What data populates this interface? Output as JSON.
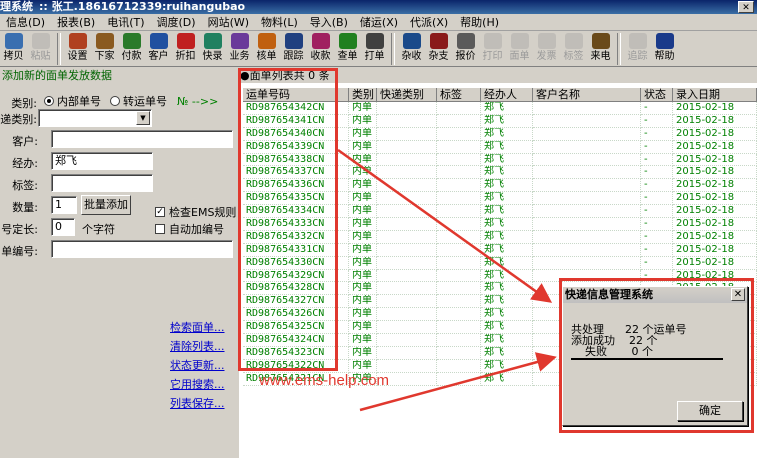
{
  "window": {
    "title": "理系统",
    "user": ":: 张工.18616712339:ruihangubao",
    "close_glyph": "✕"
  },
  "menu": [
    "信息(D)",
    "报表(B)",
    "电讯(T)",
    "调度(D)",
    "网站(W)",
    "物料(L)",
    "导入(B)",
    "储运(X)",
    "代派(X)",
    "帮助(H)"
  ],
  "toolbar": [
    {
      "label": "拷贝",
      "icon": "copy-icon",
      "color": "#3a6fb0",
      "enabled": true
    },
    {
      "label": "粘贴",
      "icon": "paste-icon",
      "color": "#9a9a9a",
      "enabled": false
    },
    {
      "sep": true
    },
    {
      "label": "设置",
      "icon": "settings-icon",
      "color": "#b04020",
      "enabled": true
    },
    {
      "label": "下家",
      "icon": "downstream-icon",
      "color": "#8a5a20",
      "enabled": true
    },
    {
      "label": "付款",
      "icon": "payment-icon",
      "color": "#2a7a2a",
      "enabled": true
    },
    {
      "label": "客户",
      "icon": "customer-icon",
      "color": "#2050a0",
      "enabled": true
    },
    {
      "label": "折扣",
      "icon": "discount-icon",
      "color": "#c02020",
      "enabled": true
    },
    {
      "label": "快录",
      "icon": "quick-entry-icon",
      "color": "#208060",
      "enabled": true
    },
    {
      "label": "业务",
      "icon": "business-icon",
      "color": "#6a3a9a",
      "enabled": true
    },
    {
      "label": "核单",
      "icon": "verify-icon",
      "color": "#c06010",
      "enabled": true
    },
    {
      "label": "跟踪",
      "icon": "track-icon",
      "color": "#204080",
      "enabled": true
    },
    {
      "label": "收款",
      "icon": "receive-icon",
      "color": "#a02060",
      "enabled": true
    },
    {
      "label": "查单",
      "icon": "query-icon",
      "color": "#208020",
      "enabled": true
    },
    {
      "label": "打单",
      "icon": "print-order-icon",
      "color": "#404040",
      "enabled": true
    },
    {
      "sep": true
    },
    {
      "label": "杂收",
      "icon": "misc-income-icon",
      "color": "#1a4a8a",
      "enabled": true
    },
    {
      "label": "杂支",
      "icon": "misc-expense-icon",
      "color": "#8a1a1a",
      "enabled": true
    },
    {
      "label": "报价",
      "icon": "quote-icon",
      "color": "#5a5a5a",
      "enabled": true
    },
    {
      "label": "打印",
      "icon": "print-icon",
      "color": "#9a9a9a",
      "enabled": false
    },
    {
      "label": "面单",
      "icon": "waybill-icon",
      "color": "#9a9a9a",
      "enabled": false
    },
    {
      "label": "发票",
      "icon": "invoice-icon",
      "color": "#9a9a9a",
      "enabled": false
    },
    {
      "label": "标签",
      "icon": "label-icon",
      "color": "#9a9a9a",
      "enabled": false
    },
    {
      "label": "来电",
      "icon": "phone-icon",
      "color": "#6a4a1a",
      "enabled": true
    },
    {
      "sep": true
    },
    {
      "label": "追踪",
      "icon": "trace-icon",
      "color": "#9a9a9a",
      "enabled": false
    },
    {
      "label": "帮助",
      "icon": "help-icon",
      "color": "#1a3a8a",
      "enabled": true
    }
  ],
  "left": {
    "header": "添加新的面单发放数据",
    "type_label": "类别:",
    "type_opt1": "内部单号",
    "type_opt2": "转运单号",
    "next_label": "№ -->>",
    "express_type_label": "递类别:",
    "express_type_value": "",
    "customer_label": "客户:",
    "customer_value": "",
    "handler_label": "经办:",
    "handler_value": "郑飞",
    "tag_label": "标签:",
    "tag_value": "",
    "qty_label": "数量:",
    "qty_value": "1",
    "batch_add": "批量添加",
    "check_ems": "检查EMS规则",
    "check_ems_checked": true,
    "len_label": "号定长:",
    "len_value": "0",
    "len_unit": "个字符",
    "auto_add": "自动加编号",
    "auto_add_checked": false,
    "start_label": "单编号:",
    "start_value": "",
    "links": [
      "检索面单...",
      "清除列表...",
      "状态更新...",
      "它用搜索...",
      "列表保存..."
    ]
  },
  "grid": {
    "title": "●面单列表共 0 条",
    "columns": [
      "运单号码",
      "类别",
      "快递类别",
      "标签",
      "经办人",
      "客户名称",
      "状态",
      "录入日期"
    ],
    "rows": [
      [
        "RD987654342CN",
        "内单",
        "",
        "",
        "郑飞",
        "",
        "-",
        "2015-02-18"
      ],
      [
        "RD987654341CN",
        "内单",
        "",
        "",
        "郑飞",
        "",
        "-",
        "2015-02-18"
      ],
      [
        "RD987654340CN",
        "内单",
        "",
        "",
        "郑飞",
        "",
        "-",
        "2015-02-18"
      ],
      [
        "RD987654339CN",
        "内单",
        "",
        "",
        "郑飞",
        "",
        "-",
        "2015-02-18"
      ],
      [
        "RD987654338CN",
        "内单",
        "",
        "",
        "郑飞",
        "",
        "-",
        "2015-02-18"
      ],
      [
        "RD987654337CN",
        "内单",
        "",
        "",
        "郑飞",
        "",
        "-",
        "2015-02-18"
      ],
      [
        "RD987654336CN",
        "内单",
        "",
        "",
        "郑飞",
        "",
        "-",
        "2015-02-18"
      ],
      [
        "RD987654335CN",
        "内单",
        "",
        "",
        "郑飞",
        "",
        "-",
        "2015-02-18"
      ],
      [
        "RD987654334CN",
        "内单",
        "",
        "",
        "郑飞",
        "",
        "-",
        "2015-02-18"
      ],
      [
        "RD987654333CN",
        "内单",
        "",
        "",
        "郑飞",
        "",
        "-",
        "2015-02-18"
      ],
      [
        "RD987654332CN",
        "内单",
        "",
        "",
        "郑飞",
        "",
        "-",
        "2015-02-18"
      ],
      [
        "RD987654331CN",
        "内单",
        "",
        "",
        "郑飞",
        "",
        "-",
        "2015-02-18"
      ],
      [
        "RD987654330CN",
        "内单",
        "",
        "",
        "郑飞",
        "",
        "-",
        "2015-02-18"
      ],
      [
        "RD987654329CN",
        "内单",
        "",
        "",
        "郑飞",
        "",
        "-",
        "2015-02-18"
      ],
      [
        "RD987654328CN",
        "内单",
        "",
        "",
        "郑飞",
        "",
        "-",
        "2015-02-18"
      ],
      [
        "RD987654327CN",
        "内单",
        "",
        "",
        "郑飞",
        "",
        "",
        ""
      ],
      [
        "RD987654326CN",
        "内单",
        "",
        "",
        "郑飞",
        "",
        "",
        ""
      ],
      [
        "RD987654325CN",
        "内单",
        "",
        "",
        "郑飞",
        "",
        "",
        ""
      ],
      [
        "RD987654324CN",
        "内单",
        "",
        "",
        "郑飞",
        "",
        "",
        ""
      ],
      [
        "RD987654323CN",
        "内单",
        "",
        "",
        "郑飞",
        "",
        "",
        ""
      ],
      [
        "RD987654322CN",
        "内单",
        "",
        "",
        "郑飞",
        "",
        "",
        ""
      ],
      [
        "RD987654321CN",
        "内单",
        "",
        "",
        "郑飞",
        "",
        "",
        ""
      ]
    ]
  },
  "dialog": {
    "title": "快递信息管理系统",
    "close": "✕",
    "line1_label": "共处理",
    "line1_num": "22",
    "line1_unit": "个运单号",
    "line2_label": "添加成功",
    "line2_num": "22",
    "line2_unit": "个",
    "line3_label": "失败",
    "line3_num": "0",
    "line3_unit": "个",
    "ok": "确定"
  },
  "watermark": "www.ems-help.com",
  "colors": {
    "annotation_red": "#e0382e",
    "row_green": "#008000"
  }
}
